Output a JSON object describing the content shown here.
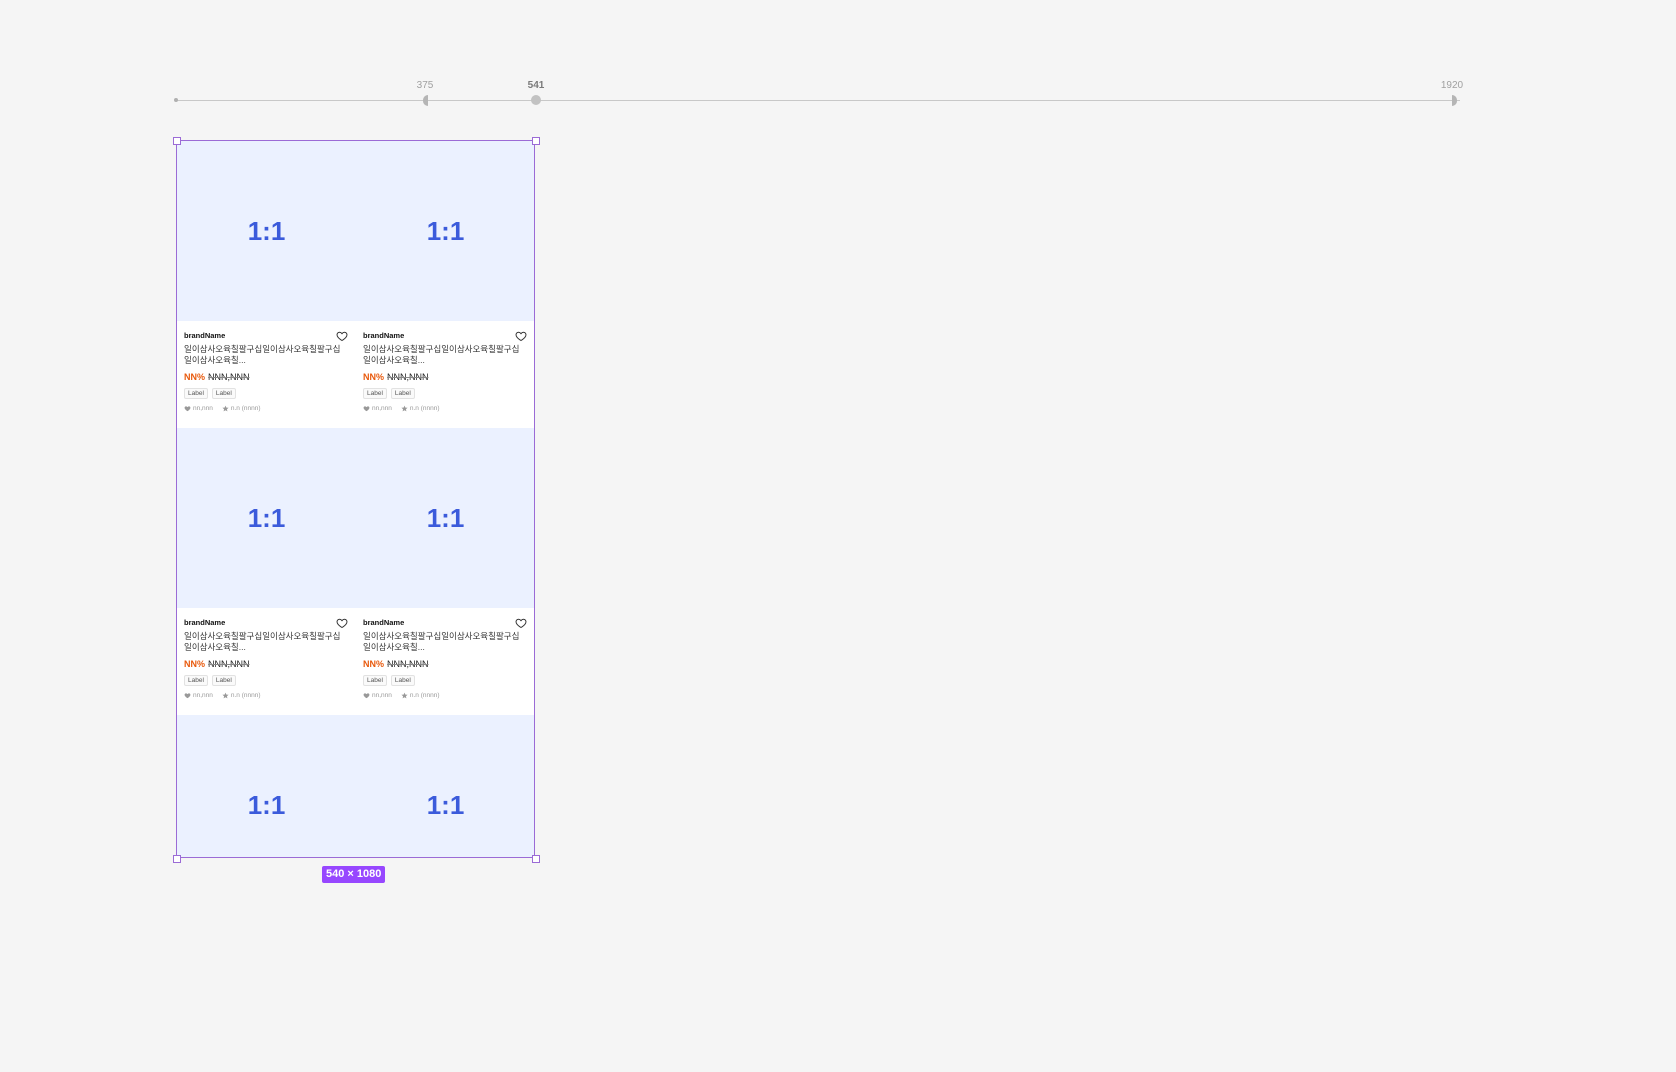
{
  "ruler": {
    "label_min": "375",
    "label_current": "541",
    "label_max": "1920"
  },
  "frame": {
    "size_label": "540 × 1080"
  },
  "colors": {
    "accent": "#9747ff",
    "frame_border": "#9b6bd6",
    "placeholder_bg": "#ebf1ff",
    "placeholder_text": "#3b5bdb",
    "discount": "#e8590c"
  },
  "products": [
    {
      "ratio": "1:1",
      "brand": "brandName",
      "title": "일이삼사오육칠팔구십일이삼사오육칠팔구십일이삼사오육칠...",
      "discount": "NN%",
      "price": "NNN,NNN",
      "labels": [
        "Label",
        "Label"
      ],
      "likes": "nn,nnn",
      "rating": "n.n (nnnn)"
    },
    {
      "ratio": "1:1",
      "brand": "brandName",
      "title": "일이삼사오육칠팔구십일이삼사오육칠팔구십일이삼사오육칠...",
      "discount": "NN%",
      "price": "NNN,NNN",
      "labels": [
        "Label",
        "Label"
      ],
      "likes": "nn,nnn",
      "rating": "n.n (nnnn)"
    },
    {
      "ratio": "1:1",
      "brand": "brandName",
      "title": "일이삼사오육칠팔구십일이삼사오육칠팔구십일이삼사오육칠...",
      "discount": "NN%",
      "price": "NNN,NNN",
      "labels": [
        "Label",
        "Label"
      ],
      "likes": "nn,nnn",
      "rating": "n.n (nnnn)"
    },
    {
      "ratio": "1:1",
      "brand": "brandName",
      "title": "일이삼사오육칠팔구십일이삼사오육칠팔구십일이삼사오육칠...",
      "discount": "NN%",
      "price": "NNN,NNN",
      "labels": [
        "Label",
        "Label"
      ],
      "likes": "nn,nnn",
      "rating": "n.n (nnnn)"
    },
    {
      "ratio": "1:1"
    },
    {
      "ratio": "1:1"
    }
  ]
}
